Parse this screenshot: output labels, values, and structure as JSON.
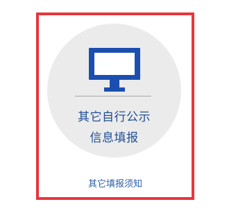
{
  "card": {
    "title_line1": "其它自行公示",
    "title_line2": "信息填报",
    "icon": "monitor-icon"
  },
  "notice_link": {
    "label": "其它填报须知"
  },
  "colors": {
    "frame_border": "#e8353b",
    "circle_bg": "#ebebeb",
    "icon_blue": "#1a4fb0",
    "title_text": "#1f4f95",
    "link_text": "#2c5ea6"
  }
}
